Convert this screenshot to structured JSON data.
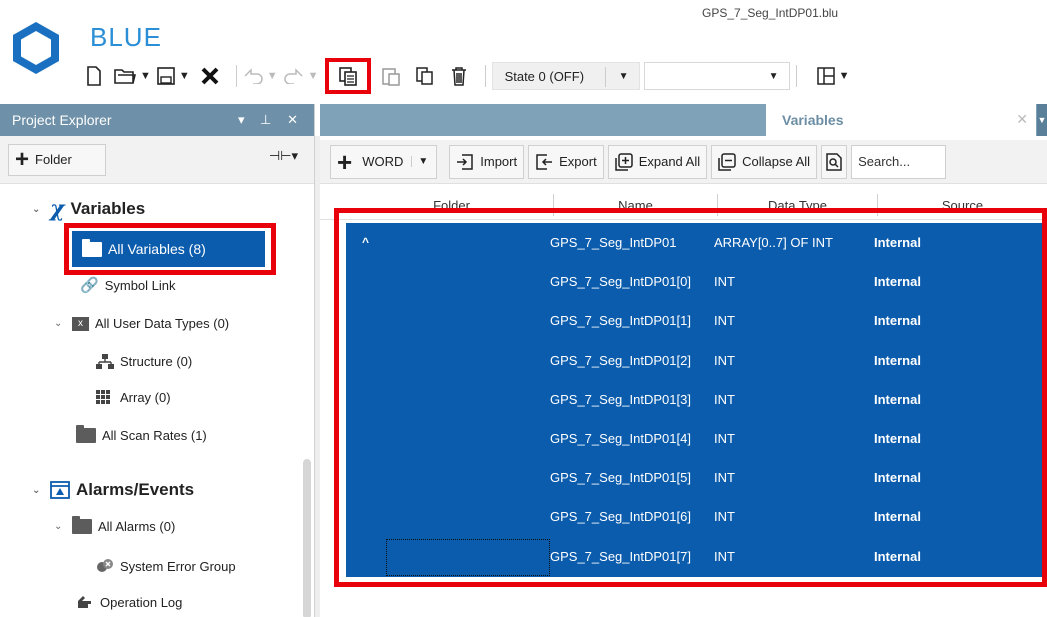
{
  "app": {
    "name": "BLUE",
    "file_title": "GPS_7_Seg_IntDP01.blu"
  },
  "toolbar": {
    "new_icon": "new-file-icon",
    "open_icon": "open-folder-icon",
    "save_icon": "save-icon",
    "close_icon": "close-icon",
    "undo_icon": "undo-icon",
    "redo_icon": "redo-icon",
    "copy_icon": "copy-icon",
    "paste_icon": "paste-icon",
    "duplicate_icon": "duplicate-icon",
    "delete_icon": "delete-icon",
    "state_value": "State 0 (OFF)",
    "layout_icon": "layout-icon",
    "highlight_color": "#e8000b"
  },
  "project_explorer": {
    "title": "Project Explorer",
    "add_folder_label": "Folder",
    "tree": {
      "variables": "Variables",
      "all_variables": "All Variables (8)",
      "symbol_link": "Symbol Link",
      "all_user_data_types": "All User Data Types (0)",
      "structure": "Structure (0)",
      "array": "Array (0)",
      "all_scan_rates": "All Scan Rates (1)",
      "alarms_events": "Alarms/Events",
      "all_alarms": "All Alarms (0)",
      "system_error_group": "System Error Group",
      "operation_log": "Operation Log"
    }
  },
  "tabs": {
    "active": "Variables"
  },
  "variables_toolbar": {
    "add_type": "WORD",
    "import_label": "Import",
    "export_label": "Export",
    "expand_all_label": "Expand All",
    "collapse_all_label": "Collapse All",
    "search_placeholder": "Search..."
  },
  "grid": {
    "columns": [
      "Folder",
      "Name",
      "Data Type",
      "Source"
    ],
    "selection_color": "#0b5cad",
    "rows": [
      {
        "expand": "^",
        "name": "GPS_7_Seg_IntDP01",
        "type": "ARRAY[0..7] OF INT",
        "source": "Internal"
      },
      {
        "expand": "",
        "name": "GPS_7_Seg_IntDP01[0]",
        "type": "INT",
        "source": "Internal"
      },
      {
        "expand": "",
        "name": "GPS_7_Seg_IntDP01[1]",
        "type": "INT",
        "source": "Internal"
      },
      {
        "expand": "",
        "name": "GPS_7_Seg_IntDP01[2]",
        "type": "INT",
        "source": "Internal"
      },
      {
        "expand": "",
        "name": "GPS_7_Seg_IntDP01[3]",
        "type": "INT",
        "source": "Internal"
      },
      {
        "expand": "",
        "name": "GPS_7_Seg_IntDP01[4]",
        "type": "INT",
        "source": "Internal"
      },
      {
        "expand": "",
        "name": "GPS_7_Seg_IntDP01[5]",
        "type": "INT",
        "source": "Internal"
      },
      {
        "expand": "",
        "name": "GPS_7_Seg_IntDP01[6]",
        "type": "INT",
        "source": "Internal"
      },
      {
        "expand": "",
        "name": "GPS_7_Seg_IntDP01[7]",
        "type": "INT",
        "source": "Internal"
      }
    ]
  }
}
